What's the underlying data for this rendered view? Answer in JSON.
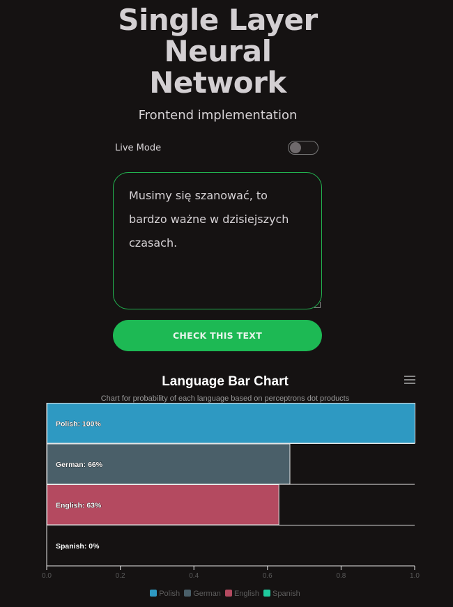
{
  "header": {
    "title_lines": [
      "Single Layer",
      "Neural",
      "Network"
    ],
    "subtitle": "Frontend implementation"
  },
  "controls": {
    "live_mode_label": "Live Mode",
    "live_mode_on": false
  },
  "input": {
    "text": "Musimy się szanować, to bardzo ważne w dzisiejszych czasach."
  },
  "check_button": {
    "label": "CHECK THIS TEXT"
  },
  "colors": {
    "accent": "#1db954",
    "background": "#151212"
  },
  "chart": {
    "menu_icon": "hamburger-menu-icon"
  },
  "chart_data": {
    "type": "bar",
    "orientation": "horizontal",
    "title": "Language Bar Chart",
    "subtitle": "Chart for probability of each language based on perceptrons dot products",
    "categories": [
      "Polish",
      "German",
      "English",
      "Spanish"
    ],
    "values": [
      1.0,
      0.66,
      0.63,
      0.0
    ],
    "data_labels": [
      "Polish: 100%",
      "German: 66%",
      "English: 63%",
      "Spanish: 0%"
    ],
    "colors": [
      "#2e99c2",
      "#4a5f69",
      "#b44a60",
      "#1fc99d"
    ],
    "xlim": [
      0,
      1
    ],
    "x_ticks": [
      "0.0",
      "0.2",
      "0.4",
      "0.6",
      "0.8",
      "1.0"
    ],
    "legend": {
      "position": "bottom",
      "items": [
        "Polish",
        "German",
        "English",
        "Spanish"
      ]
    }
  }
}
